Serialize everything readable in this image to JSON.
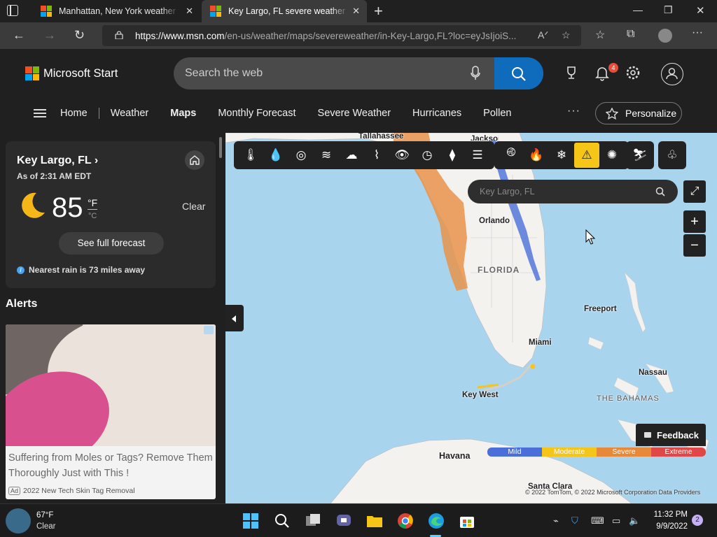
{
  "browser": {
    "tabs": [
      {
        "title": "Manhattan, New York weather forecast"
      },
      {
        "title": "Key Largo, FL severe weather | MSN Weather"
      }
    ],
    "url_host": "https://www.msn.com",
    "url_path": "/en-us/weather/maps/severeweather/in-Key-Largo,FL?loc=eyJsIjoiS..."
  },
  "header": {
    "brand": "Microsoft Start",
    "search_placeholder": "Search the web",
    "notification_count": "4",
    "nav": [
      "Home",
      "Weather",
      "Maps",
      "Monthly Forecast",
      "Severe Weather",
      "Hurricanes",
      "Pollen"
    ],
    "more": "···",
    "personalize": "Personalize"
  },
  "weather": {
    "location": "Key Largo, FL",
    "as_of": "As of 2:31 AM EDT",
    "temperature": "85",
    "unit_f": "°F",
    "unit_c": "°C",
    "condition": "Clear",
    "forecast_button": "See full forecast",
    "rain_note": "Nearest rain is 73 miles away"
  },
  "alerts": {
    "heading": "Alerts"
  },
  "ad": {
    "text": "Suffering from Moles or Tags? Remove Them Thoroughly Just with This !",
    "tag": "Ad",
    "source": "2022 New Tech Skin Tag Removal"
  },
  "map": {
    "search_placeholder": "Key Largo, FL",
    "labels": {
      "tallahassee": "Tallahassee",
      "jacksonville": "Jacksonville",
      "orlando": "Orlando",
      "florida": "FLORIDA",
      "freeport": "Freeport",
      "miami": "Miami",
      "nassau": "Nassau",
      "key_west": "Key West",
      "bahamas": "THE BAHAMAS",
      "havana": "Havana",
      "santa_clara": "Santa Clara"
    },
    "legend": [
      {
        "label": "Mild",
        "color": "#4a6fd8"
      },
      {
        "label": "Moderate",
        "color": "#f5c518"
      },
      {
        "label": "Severe",
        "color": "#e8893a"
      },
      {
        "label": "Extreme",
        "color": "#e04848"
      }
    ],
    "feedback": "Feedback",
    "copyright": "© 2022 TomTom, © 2022 Microsoft Corporation  Data Providers"
  },
  "taskbar": {
    "temp": "67°F",
    "condition": "Clear",
    "time": "11:32 PM",
    "date": "9/9/2022",
    "notification_count": "2"
  }
}
